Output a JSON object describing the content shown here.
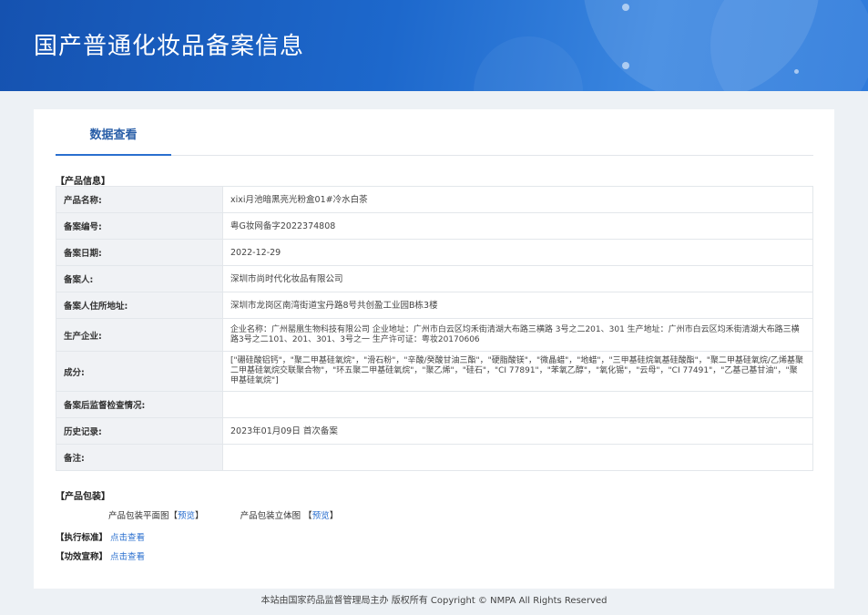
{
  "header": {
    "title": "国产普通化妆品备案信息"
  },
  "tab": {
    "label": "数据查看"
  },
  "product_info": {
    "section_title": "【产品信息】",
    "rows": [
      {
        "label": "产品名称:",
        "value": "xixi月池暗黑亮光粉盒01#冷水白茶"
      },
      {
        "label": "备案编号:",
        "value": "粤G妆网备字2022374808"
      },
      {
        "label": "备案日期:",
        "value": "2022-12-29"
      },
      {
        "label": "备案人:",
        "value": "深圳市尚时代化妆品有限公司"
      },
      {
        "label": "备案人住所地址:",
        "value": "深圳市龙岗区南湾街道宝丹路8号共创盈工业园B栋3楼"
      },
      {
        "label": "生产企业:",
        "value": "企业名称：广州罂凰生物科技有限公司 企业地址：广州市白云区均禾街清湖大布路三横路 3号之二201、301 生产地址：广州市白云区均禾街清湖大布路三横路3号之二101、201、301、3号之一 生产许可证：粤妆20170606"
      },
      {
        "label": "成分:",
        "value": "[\"硼硅酸铝钙\"，\"聚二甲基硅氧烷\"，\"滑石粉\"，\"辛酸/癸酸甘油三酯\"，\"硬脂酸镁\"，\"微晶蜡\"，\"地蜡\"，\"三甲基硅烷氧基硅酸酯\"，\"聚二甲基硅氧烷/乙烯基聚二甲基硅氧烷交联聚合物\"，\"环五聚二甲基硅氧烷\"，\"聚乙烯\"，\"硅石\"，\"CI 77891\"，\"苯氧乙醇\"，\"氧化锡\"，\"云母\"，\"CI 77491\"，\"乙基己基甘油\"，\"聚甲基硅氧烷\"]"
      },
      {
        "label": "备案后监督检查情况:",
        "value": ""
      },
      {
        "label": "历史记录:",
        "value": "2023年01月09日 首次备案"
      },
      {
        "label": "备注:",
        "value": ""
      }
    ]
  },
  "packaging": {
    "section_title": "【产品包装】",
    "flat_label": "产品包装平面图",
    "solid_label": "产品包装立体图",
    "preview_link": "预览",
    "bracket_open": "【",
    "bracket_close": "】"
  },
  "standard": {
    "label": "【执行标准】",
    "link": "点击查看"
  },
  "efficacy": {
    "label": "【功效宣称】",
    "link": "点击查看"
  },
  "footer": {
    "text": "本站由国家药品监督管理局主办 版权所有 Copyright © NMPA All Rights Reserved"
  }
}
